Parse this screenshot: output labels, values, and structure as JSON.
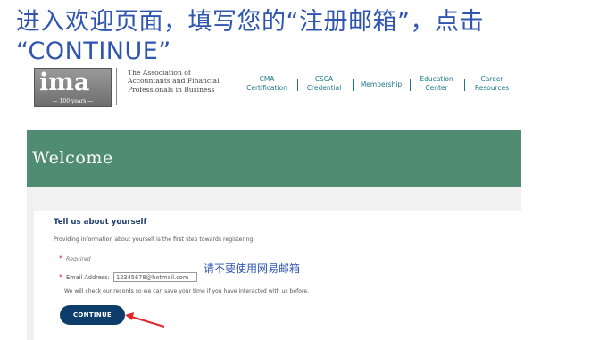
{
  "instruction": {
    "line1": "进入欢迎页面，填写您的“注册邮箱”，点击",
    "line2": "“CONTINUE”"
  },
  "header": {
    "logo_text": "ima",
    "logo_sub": "— 100 years —",
    "org_name": "The Association of Accountants and Financial Professionals in Business",
    "nav": [
      {
        "line1": "CMA",
        "line2": "Certification"
      },
      {
        "line1": "CSCA",
        "line2": "Credential"
      },
      {
        "line1": "Membership",
        "line2": ""
      },
      {
        "line1": "Education",
        "line2": "Center"
      },
      {
        "line1": "Career",
        "line2": "Resources"
      }
    ]
  },
  "page": {
    "banner_title": "Welcome",
    "heading": "Tell us about yourself",
    "intro": "Providing information about yourself is the first step towards registering.",
    "required_label": "Required",
    "email_label": "Email Address:",
    "email_value": "12345678@hotmail.com",
    "check_note": "We will check our records so we can save your time if you have interacted with us before.",
    "continue_label": "CONTINUE"
  },
  "annotation": {
    "note": "请不要使用网易邮箱",
    "arrow_color": "#e3262e"
  },
  "colors": {
    "instruction": "#2f55b0",
    "banner": "#4f8c72",
    "button": "#0f3d6b",
    "nav": "#1a7a8a"
  }
}
